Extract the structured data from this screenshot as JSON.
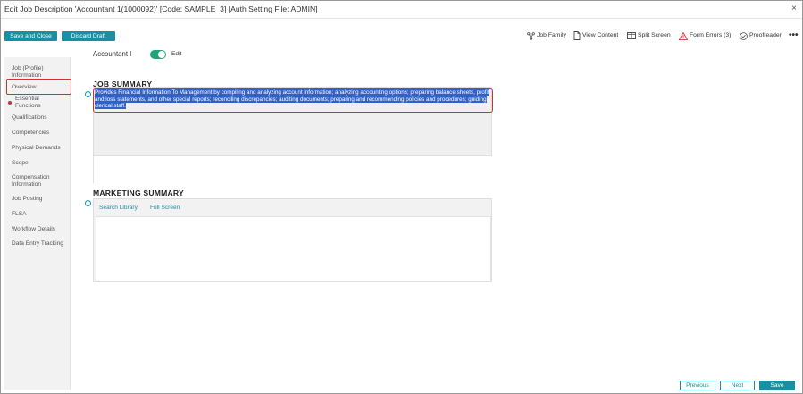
{
  "window": {
    "title": "Edit Job Description 'Accountant 1(1000092)'  [Code: SAMPLE_3] [Auth Setting File: ADMIN]",
    "close_glyph": "×"
  },
  "toolbar": {
    "save_close_label": "Save and Close",
    "discard_label": "Discard Draft",
    "job_family_label": "Job Family",
    "view_content_label": "View Content",
    "split_screen_label": "Split Screen",
    "form_errors_label": "Form Errors (3)",
    "proofreader_label": "Proofreader",
    "more_glyph": "•••",
    "icons": [
      "job-family-icon",
      "document-icon",
      "split-screen-icon",
      "warning-icon",
      "check-circle-icon",
      "more-icon"
    ],
    "error_color": "#d32f2f"
  },
  "sidebar": {
    "active": "Overview",
    "items": [
      {
        "label": "Job (Profile)\nInformation"
      },
      {
        "label": "Overview"
      },
      {
        "label": "Essential\nFunctions"
      },
      {
        "label": "Qualifications"
      },
      {
        "label": "Competencies"
      },
      {
        "label": "Physical Demands"
      },
      {
        "label": "Scope"
      },
      {
        "label": "Compensation\nInformation"
      },
      {
        "label": "Job Posting"
      },
      {
        "label": "FLSA"
      },
      {
        "label": "Workflow Details"
      },
      {
        "label": "Data Entry Tracking"
      }
    ]
  },
  "header": {
    "job_title": "Accountant I",
    "edit_label": "Edit",
    "edit_toggle_on": true,
    "toggle_color": "#1fa47a"
  },
  "job_summary": {
    "title": "JOB SUMMARY",
    "info_glyph": "i",
    "text": "Provides Financial Information To Management by compiling and analyzing account information; analyzing accounting options; preparing balance sheets, profit and loss statements, and other special reports; reconciling discrepancies; auditing documents; preparing and recommending policies and procedures; guiding clerical staff.",
    "selection_color": "#2f62c4"
  },
  "marketing_summary": {
    "title": "MARKETING SUMMARY",
    "info_glyph": "i",
    "search_library_label": "Search Library",
    "full_screen_label": "Full Screen",
    "content": ""
  },
  "footer": {
    "previous_label": "Previous",
    "next_label": "Next",
    "save_label": "Save"
  },
  "colors": {
    "accent": "#1a8fa3",
    "error": "#d32f2f"
  }
}
